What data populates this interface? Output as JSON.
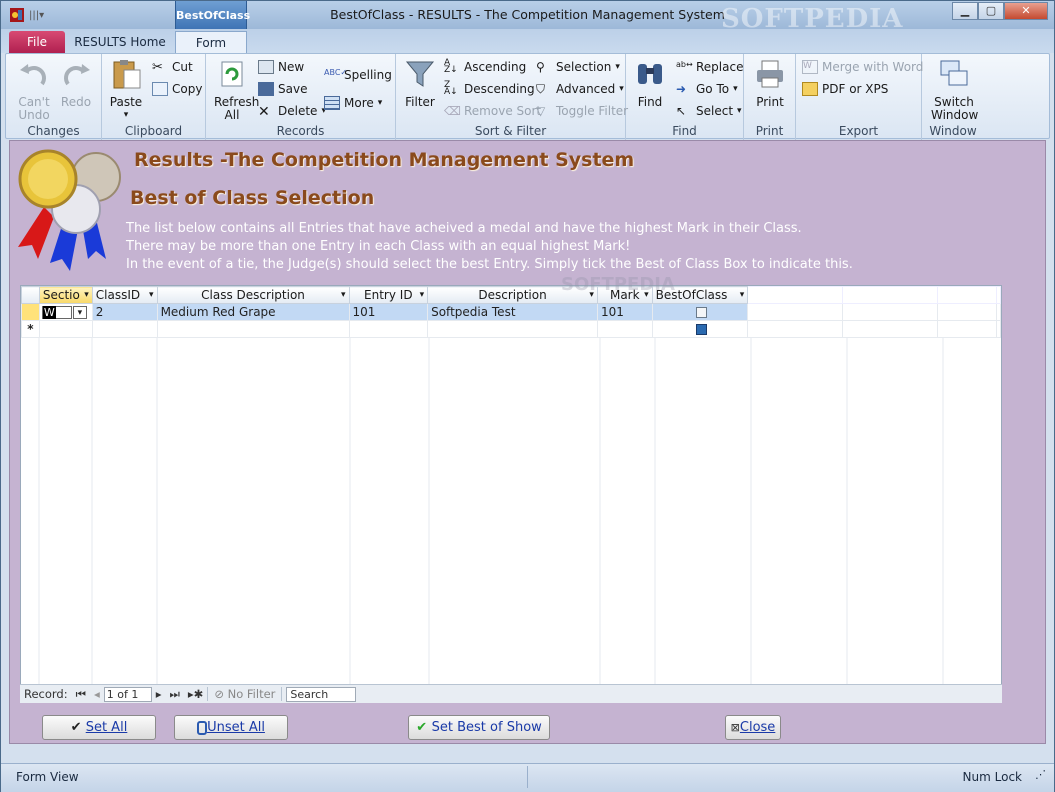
{
  "window": {
    "title": "BestOfClass  -  RESULTS - The Competition Management System",
    "watermark": "SOFTPEDIA",
    "contextual_tab": "BestOfClass"
  },
  "tabs": {
    "file": "File",
    "home": "RESULTS Home",
    "form": "Form"
  },
  "ribbon": {
    "changes": {
      "label": "Changes",
      "undo": "Can't Undo",
      "redo": "Redo"
    },
    "clipboard": {
      "label": "Clipboard",
      "paste": "Paste",
      "cut": "Cut",
      "copy": "Copy"
    },
    "records": {
      "label": "Records",
      "refresh": "Refresh All",
      "new": "New",
      "save": "Save",
      "delete": "Delete",
      "spelling": "Spelling",
      "more": "More"
    },
    "sortfilter": {
      "label": "Sort & Filter",
      "filter": "Filter",
      "ascending": "Ascending",
      "descending": "Descending",
      "remove_sort": "Remove Sort",
      "selection": "Selection",
      "advanced": "Advanced",
      "toggle_filter": "Toggle Filter"
    },
    "find": {
      "label": "Find",
      "find": "Find",
      "replace": "Replace",
      "goto": "Go To",
      "select": "Select"
    },
    "print": {
      "label": "Print",
      "print": "Print"
    },
    "export": {
      "label": "Export",
      "merge": "Merge with Word",
      "pdf": "PDF or XPS"
    },
    "window": {
      "label": "Window",
      "switch": "Switch Window"
    }
  },
  "form": {
    "title": "Results -The Competition Management System",
    "subtitle": "Best of Class Selection",
    "info1": "The list below contains all Entries that have acheived a medal and have the highest Mark in their Class.",
    "info2": "There may be more than one Entry in each Class with an equal highest Mark!",
    "info3": "In the event of a tie, the Judge(s) should select the best Entry. Simply tick the Best of Class Box to indicate this."
  },
  "grid": {
    "columns": [
      "Sectio",
      "ClassID",
      "Class Description",
      "Entry ID",
      "Description",
      "Mark",
      "BestOfClass"
    ],
    "rows": [
      {
        "section": "W",
        "classid": "2",
        "class_desc": "Medium Red Grape",
        "entry_id": "101",
        "desc": "Softpedia Test",
        "mark": "101",
        "best": false
      }
    ],
    "new_row_marker": "*",
    "watermark": "SOFTPEDIA"
  },
  "navbar": {
    "record_label": "Record:",
    "record_value": "1 of 1",
    "no_filter": "No Filter",
    "search": "Search"
  },
  "buttons": {
    "set_all": "Set All",
    "unset_all": "Unset All",
    "set_best": "Set Best of Show",
    "close": "Close"
  },
  "status": {
    "left": "Form View",
    "right": "Num Lock"
  }
}
